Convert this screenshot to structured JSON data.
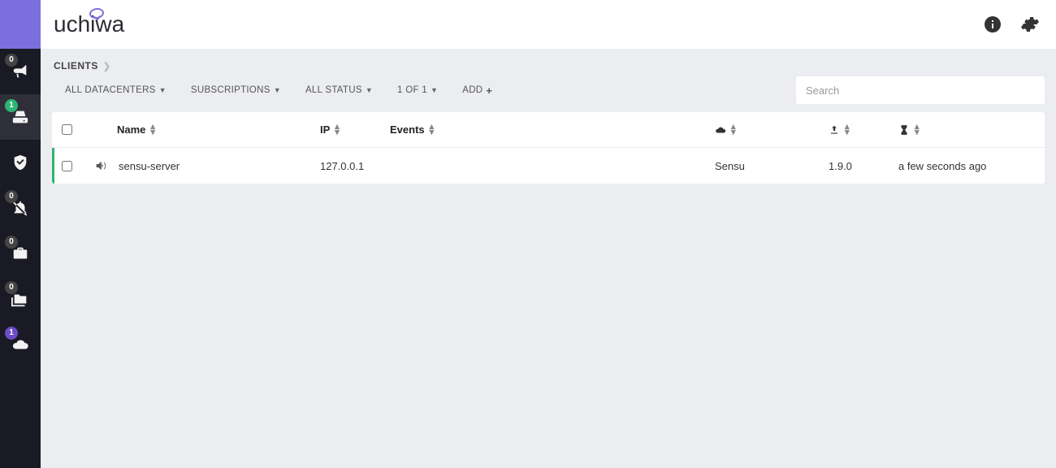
{
  "brand": "uchiwa",
  "sidebar": {
    "items": [
      {
        "name": "events",
        "badge": "0",
        "badge_color": "gray"
      },
      {
        "name": "clients",
        "badge": "1",
        "badge_color": "green",
        "active": true
      },
      {
        "name": "checks",
        "badge": "",
        "badge_color": ""
      },
      {
        "name": "silenced",
        "badge": "0",
        "badge_color": "gray"
      },
      {
        "name": "stashes",
        "badge": "0",
        "badge_color": "gray"
      },
      {
        "name": "aggregates",
        "badge": "0",
        "badge_color": "gray"
      },
      {
        "name": "datacenters",
        "badge": "1",
        "badge_color": "purple"
      }
    ]
  },
  "breadcrumb": {
    "section": "CLIENTS"
  },
  "toolbar": {
    "datacenters": "ALL DATACENTERS",
    "subscriptions": "SUBSCRIPTIONS",
    "status": "ALL STATUS",
    "page": "1 OF 1",
    "add": "ADD"
  },
  "search": {
    "placeholder": "Search",
    "value": ""
  },
  "table": {
    "headers": {
      "name": "Name",
      "ip": "IP",
      "events": "Events"
    },
    "rows": [
      {
        "name": "sensu-server",
        "ip": "127.0.0.1",
        "events": "",
        "datacenter": "Sensu",
        "version": "1.9.0",
        "time": "a few seconds ago"
      }
    ]
  }
}
